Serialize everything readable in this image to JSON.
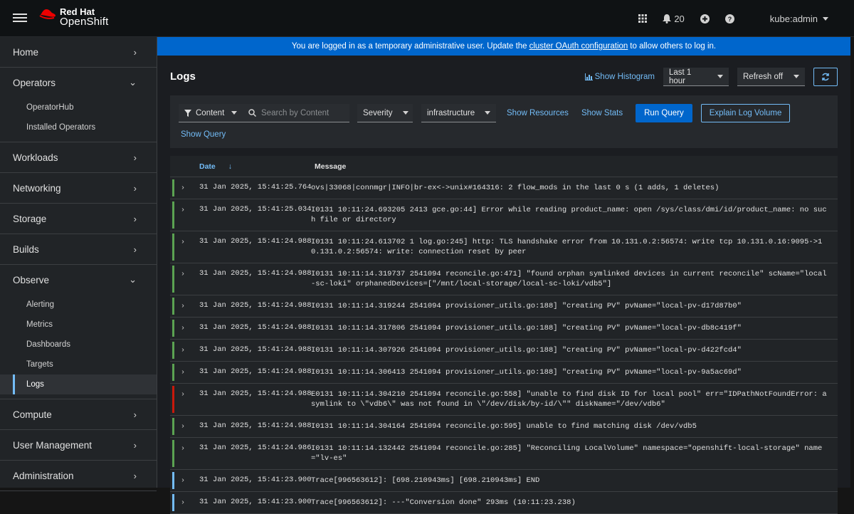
{
  "masthead": {
    "brand_line1": "Red Hat",
    "brand_line2": "OpenShift",
    "notifications_count": "20",
    "user": "kube:admin"
  },
  "sidebar": {
    "sections": [
      {
        "label": "Home",
        "expanded": false
      },
      {
        "label": "Operators",
        "expanded": true,
        "items": [
          "OperatorHub",
          "Installed Operators"
        ]
      },
      {
        "label": "Workloads",
        "expanded": false
      },
      {
        "label": "Networking",
        "expanded": false
      },
      {
        "label": "Storage",
        "expanded": false
      },
      {
        "label": "Builds",
        "expanded": false
      },
      {
        "label": "Observe",
        "expanded": true,
        "items": [
          "Alerting",
          "Metrics",
          "Dashboards",
          "Targets",
          "Logs"
        ],
        "active": "Logs"
      },
      {
        "label": "Compute",
        "expanded": false
      },
      {
        "label": "User Management",
        "expanded": false
      },
      {
        "label": "Administration",
        "expanded": false
      }
    ]
  },
  "banner": {
    "text_before": "You are logged in as a temporary administrative user. Update the",
    "link": "cluster OAuth configuration",
    "text_after": "to allow others to log in."
  },
  "page": {
    "title": "Logs",
    "show_histogram": "Show Histogram",
    "time_range": "Last 1 hour",
    "refresh": "Refresh off"
  },
  "filters": {
    "attribute": "Content",
    "search_placeholder": "Search by Content",
    "severity": "Severity",
    "tenant": "infrastructure",
    "show_resources": "Show Resources",
    "show_stats": "Show Stats",
    "run_query": "Run Query",
    "explain": "Explain Log Volume",
    "show_query": "Show Query"
  },
  "table": {
    "col_date": "Date",
    "col_message": "Message",
    "rows": [
      {
        "date": "31 Jan 2025, 15:41:25.764",
        "message": "ovs|33068|connmgr|INFO|br-ex<->unix#164316: 2 flow_mods in the last 0 s (1 adds, 1 deletes)",
        "severity": "info"
      },
      {
        "date": "31 Jan 2025, 15:41:25.034",
        "message": "I0131 10:11:24.693205 2413 gce.go:44] Error while reading product_name: open /sys/class/dmi/id/product_name: no such file or directory",
        "severity": "info"
      },
      {
        "date": "31 Jan 2025, 15:41:24.988",
        "message": "I0131 10:11:24.613702 1 log.go:245] http: TLS handshake error from 10.131.0.2:56574: write tcp 10.131.0.16:9095->10.131.0.2:56574: write: connection reset by peer",
        "severity": "info"
      },
      {
        "date": "31 Jan 2025, 15:41:24.988",
        "message": "I0131 10:11:14.319737 2541094 reconcile.go:471] \"found orphan symlinked devices in current reconcile\" scName=\"local-sc-loki\" orphanedDevices=[\"/mnt/local-storage/local-sc-loki/vdb5\"]",
        "severity": "info"
      },
      {
        "date": "31 Jan 2025, 15:41:24.988",
        "message": "I0131 10:11:14.319244 2541094 provisioner_utils.go:188] \"creating PV\" pvName=\"local-pv-d17d87b0\"",
        "severity": "info"
      },
      {
        "date": "31 Jan 2025, 15:41:24.988",
        "message": "I0131 10:11:14.317806 2541094 provisioner_utils.go:188] \"creating PV\" pvName=\"local-pv-db8c419f\"",
        "severity": "info"
      },
      {
        "date": "31 Jan 2025, 15:41:24.988",
        "message": "I0131 10:11:14.307926 2541094 provisioner_utils.go:188] \"creating PV\" pvName=\"local-pv-d422fcd4\"",
        "severity": "info"
      },
      {
        "date": "31 Jan 2025, 15:41:24.988",
        "message": "I0131 10:11:14.306413 2541094 provisioner_utils.go:188] \"creating PV\" pvName=\"local-pv-9a5ac69d\"",
        "severity": "info"
      },
      {
        "date": "31 Jan 2025, 15:41:24.988",
        "message": "E0131 10:11:14.304210 2541094 reconcile.go:558] \"unable to find disk ID for local pool\" err=\"IDPathNotFoundError: a symlink to \\\"vdb6\\\" was not found in \\\"/dev/disk/by-id/\\\"\" diskName=\"/dev/vdb6\"",
        "severity": "error"
      },
      {
        "date": "31 Jan 2025, 15:41:24.988",
        "message": "I0131 10:11:14.304164 2541094 reconcile.go:595] unable to find matching disk /dev/vdb5",
        "severity": "info"
      },
      {
        "date": "31 Jan 2025, 15:41:24.986",
        "message": "I0131 10:11:14.132442 2541094 reconcile.go:285] \"Reconciling LocalVolume\" namespace=\"openshift-local-storage\" name=\"lv-es\"",
        "severity": "info"
      },
      {
        "date": "31 Jan 2025, 15:41:23.900",
        "message": "Trace[996563612]: [698.210943ms] [698.210943ms] END",
        "severity": "trace"
      },
      {
        "date": "31 Jan 2025, 15:41:23.900",
        "message": "Trace[996563612]: ---\"Conversion done\" 293ms (10:11:23.238)",
        "severity": "trace"
      }
    ]
  },
  "colors": {
    "info": "#5ba352",
    "error": "#c9190b",
    "trace": "#73bcf7",
    "accent": "#0066cc",
    "link": "#73bcf7"
  }
}
